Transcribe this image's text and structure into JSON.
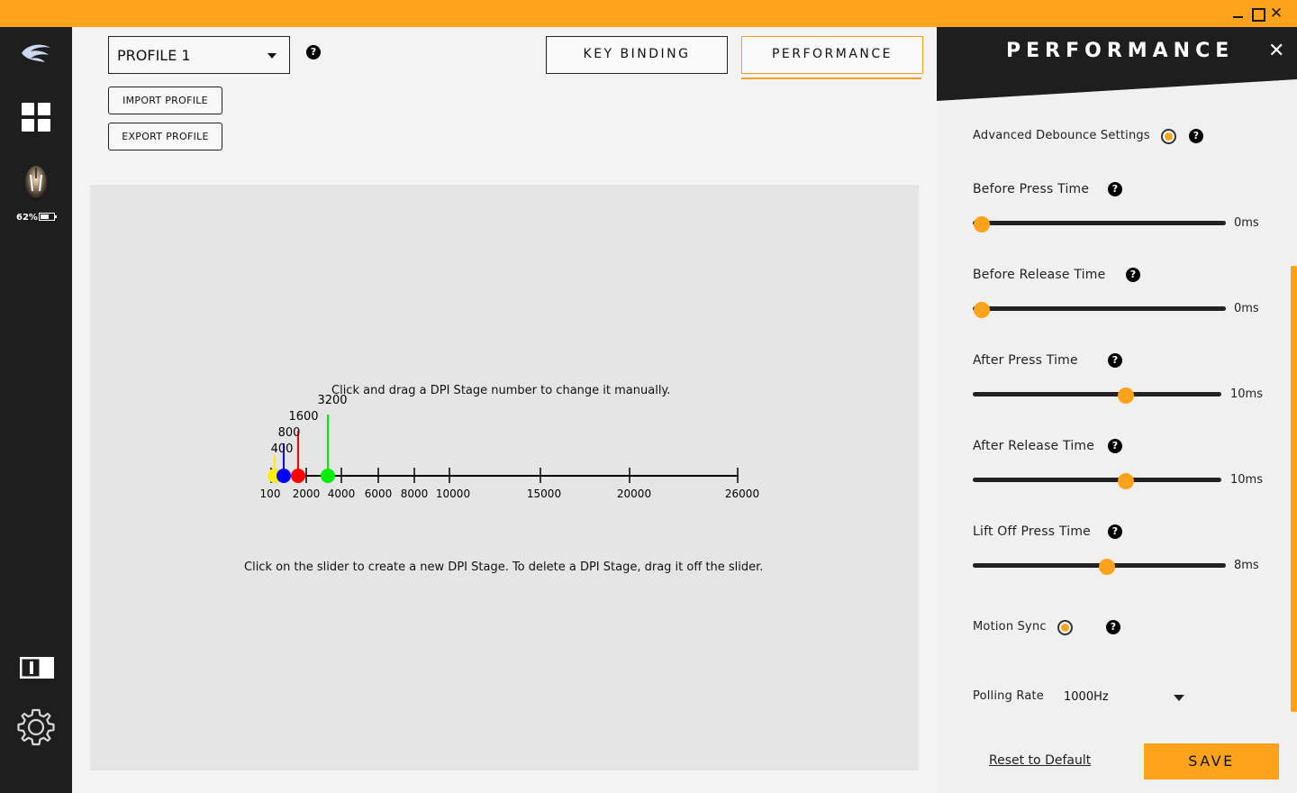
{
  "window": {
    "minimize_icon": "minimize-icon",
    "maximize_icon": "maximize-icon",
    "close_glyph": "✕",
    "accent_color": "#fea31b"
  },
  "sidebar": {
    "battery_text": "62%",
    "battery_level": 0.62,
    "icons": [
      "logo-icon",
      "grid-icon",
      "mouse-icon",
      "battery-icon",
      "panel-icon",
      "gear-icon"
    ]
  },
  "main": {
    "profile_select": {
      "value": "PROFILE 1"
    },
    "help_glyph": "?",
    "import_label": "IMPORT PROFILE",
    "export_label": "EXPORT PROFILE",
    "tabs": [
      {
        "label": "KEY BINDING",
        "active": false
      },
      {
        "label": "PERFORMANCE",
        "active": true
      }
    ],
    "dpi": {
      "hint_top": "Click and drag a DPI Stage number to change it manually.",
      "hint_bottom": "Click on the slider to create a new DPI Stage. To delete a DPI Stage, drag it off the slider.",
      "scale_min": 100,
      "scale_max": 26000,
      "ticks": [
        100,
        2000,
        4000,
        6000,
        8000,
        10000,
        15000,
        20000,
        26000
      ],
      "stages": [
        {
          "value": 400,
          "color": "#ffee00"
        },
        {
          "value": 800,
          "color": "#0000ff"
        },
        {
          "value": 1600,
          "color": "#ff0000"
        },
        {
          "value": 3200,
          "color": "#00ee00"
        }
      ]
    }
  },
  "performance": {
    "title": "PERFORMANCE",
    "close_glyph": "✕",
    "advanced_debounce": {
      "label": "Advanced Debounce Settings",
      "enabled": true
    },
    "sliders": [
      {
        "label": "Before Press Time",
        "value": 0,
        "display": "0ms",
        "max": 30
      },
      {
        "label": "Before Release Time",
        "value": 0,
        "display": "0ms",
        "max": 30
      },
      {
        "label": "After Press Time",
        "value": 10,
        "display": "10ms",
        "max": 16
      },
      {
        "label": "After Release Time",
        "value": 10,
        "display": "10ms",
        "max": 16
      },
      {
        "label": "Lift Off Press Time",
        "value": 8,
        "display": "8ms",
        "max": 15
      }
    ],
    "motion_sync": {
      "label": "Motion Sync",
      "enabled": true
    },
    "polling_rate": {
      "label": "Polling Rate",
      "value": "1000Hz"
    },
    "reset_label": "Reset to Default",
    "save_label": "SAVE"
  }
}
